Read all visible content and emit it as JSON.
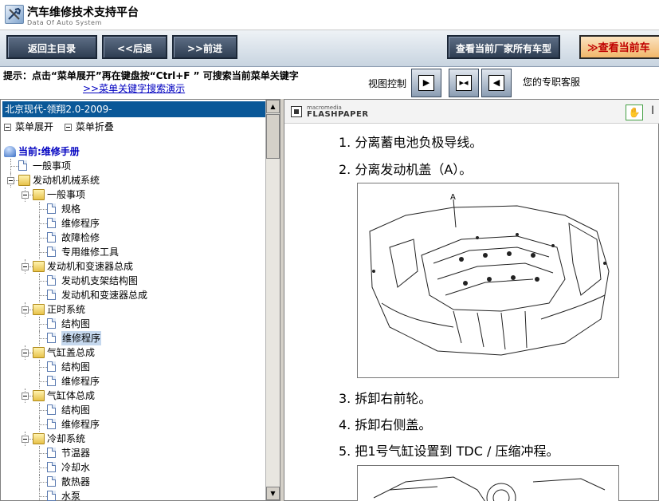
{
  "app": {
    "title": "汽车维修技术支持平台",
    "subtitle": "Data Of Auto System"
  },
  "toolbar": {
    "home_label": "返回主目录",
    "back_label": "<<后退",
    "forward_label": ">>前进",
    "makers_label": "查看当前厂家所有车型",
    "current_label": "≫查看当前车"
  },
  "hint": {
    "text": "提示：点击“菜单展开”再在键盘按“Ctrl+F ” 可搜索当前菜单关键字",
    "link": ">>菜单关键字搜索演示",
    "view_label": "视图控制",
    "support_label": "您的专职客服"
  },
  "left": {
    "vehicle": "北京现代-领翔2.0-2009-",
    "expand_label": "菜单展开",
    "collapse_label": "菜单折叠",
    "tree": [
      {
        "label": "当前:维修手册",
        "type": "root",
        "level": 0
      },
      {
        "label": "一般事项",
        "type": "doc",
        "level": 1
      },
      {
        "label": "发动机机械系统",
        "type": "folder",
        "level": 1
      },
      {
        "label": "一般事项",
        "type": "folder",
        "level": 2
      },
      {
        "label": "规格",
        "type": "doc",
        "level": 3
      },
      {
        "label": "维修程序",
        "type": "doc",
        "level": 3
      },
      {
        "label": "故障检修",
        "type": "doc",
        "level": 3
      },
      {
        "label": "专用维修工具",
        "type": "doc",
        "level": 3
      },
      {
        "label": "发动机和变速器总成",
        "type": "folder",
        "level": 2
      },
      {
        "label": "发动机支架结构图",
        "type": "doc",
        "level": 3
      },
      {
        "label": "发动机和变速器总成",
        "type": "doc",
        "level": 3
      },
      {
        "label": "正时系统",
        "type": "folder",
        "level": 2
      },
      {
        "label": "结构图",
        "type": "doc",
        "level": 3
      },
      {
        "label": "维修程序",
        "type": "doc",
        "level": 3,
        "selected": true
      },
      {
        "label": "气缸盖总成",
        "type": "folder",
        "level": 2
      },
      {
        "label": "结构图",
        "type": "doc",
        "level": 3
      },
      {
        "label": "维修程序",
        "type": "doc",
        "level": 3
      },
      {
        "label": "气缸体总成",
        "type": "folder",
        "level": 2
      },
      {
        "label": "结构图",
        "type": "doc",
        "level": 3
      },
      {
        "label": "维修程序",
        "type": "doc",
        "level": 3
      },
      {
        "label": "冷却系统",
        "type": "folder",
        "level": 2
      },
      {
        "label": "节温器",
        "type": "doc",
        "level": 3
      },
      {
        "label": "冷却水",
        "type": "doc",
        "level": 3
      },
      {
        "label": "散热器",
        "type": "doc",
        "level": 3
      },
      {
        "label": "水泵",
        "type": "doc",
        "level": 3
      }
    ]
  },
  "viewer": {
    "brand_small": "macromedia",
    "brand_big": "FLASHPAPER",
    "steps": [
      "1. 分离蓄电池负极导线。",
      "2. 分离发动机盖（A）。",
      "3. 拆卸右前轮。",
      "4. 拆卸右侧盖。",
      "5. 把1号气缸设置到 TDC / 压缩冲程。"
    ],
    "figure_label": "A"
  },
  "icons": {
    "logo": "wrench-screwdriver-icon",
    "hand": "hand-tool-icon"
  }
}
